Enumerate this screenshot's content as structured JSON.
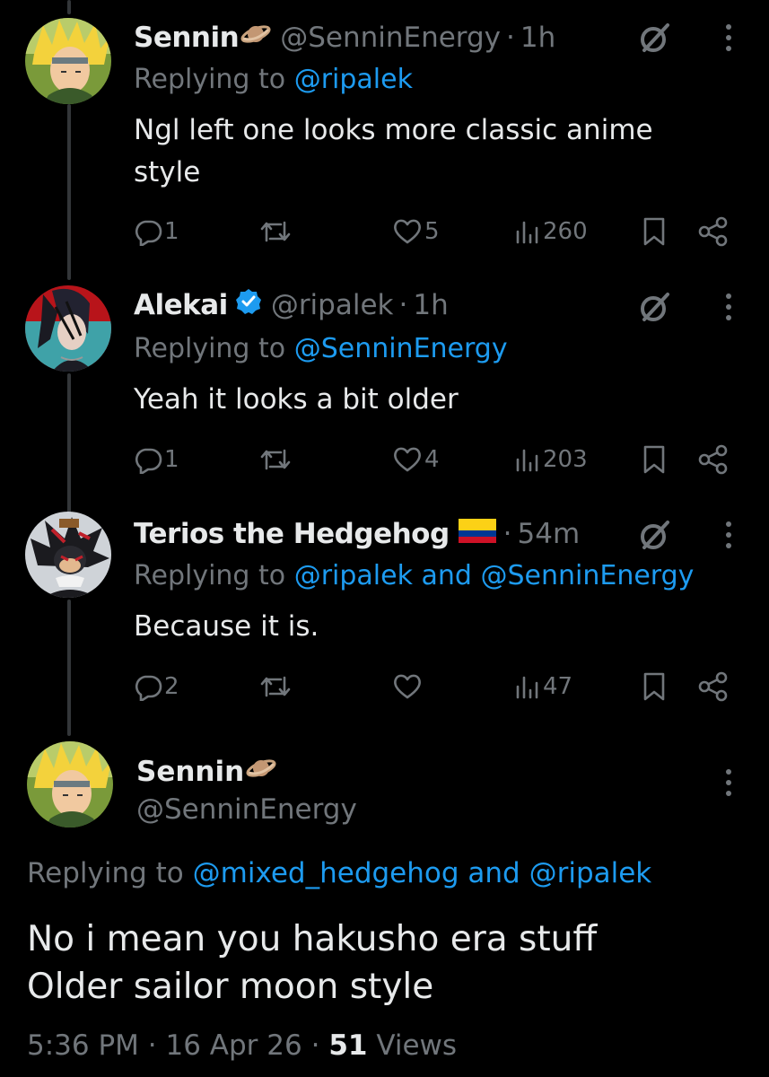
{
  "replies": [
    {
      "name": "Sennin",
      "name_emoji": "ringed-planet",
      "handle": "@SenninEnergy",
      "time": "1h",
      "replying_label": "Replying to",
      "replying_to": "@ripalek",
      "text_line1": "Ngl left one looks more classic anime",
      "text_line2": "style",
      "replies": "1",
      "likes": "5",
      "views": "260"
    },
    {
      "name": "Alekai",
      "verified": true,
      "handle": "@ripalek",
      "time": "1h",
      "replying_label": "Replying to",
      "replying_to": "@SenninEnergy",
      "text_line1": "Yeah it looks a bit older",
      "replies": "1",
      "likes": "4",
      "views": "203"
    },
    {
      "name": "Terios the Hedgehog",
      "name_emoji": "colombia-flag",
      "time": "54m",
      "replying_label": "Replying to",
      "replying_to_1": "@ripalek",
      "and": "and",
      "replying_to_2": "@SenninEnergy",
      "text_line1": "Because it is.",
      "replies": "2",
      "likes": "",
      "views": "47"
    }
  ],
  "main_tweet": {
    "name": "Sennin",
    "name_emoji": "ringed-planet",
    "handle": "@SenninEnergy",
    "replying_label": "Replying to",
    "replying_to_1": "@mixed_hedgehog",
    "and": "and",
    "replying_to_2": "@ripalek",
    "text_line1": "No i mean you hakusho era stuff",
    "text_line2": "Older sailor moon style",
    "time": "5:36 PM",
    "date": "16 Apr 26",
    "views_count": "51",
    "views_label": "Views"
  },
  "colors": {
    "background": "#000000",
    "text": "#e7e9ea",
    "muted": "#71767b",
    "link": "#1d9bf0"
  }
}
